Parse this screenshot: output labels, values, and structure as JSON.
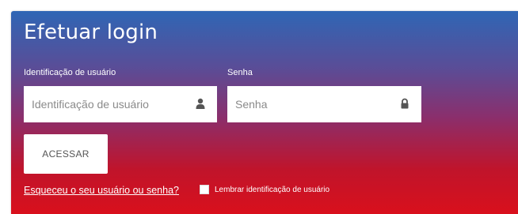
{
  "login": {
    "title": "Efetuar login",
    "username": {
      "label": "Identificação de usuário",
      "placeholder": "Identificação de usuário",
      "icon": "user-icon"
    },
    "password": {
      "label": "Senha",
      "placeholder": "Senha",
      "icon": "lock-icon"
    },
    "submit_label": "ACESSAR",
    "forgot_link": "Esqueceu o seu usuário ou senha?",
    "remember_label": "Lembrar identificação de usuário",
    "remember_checked": false
  },
  "colors": {
    "gradient_top": "#2f66b5",
    "gradient_bottom": "#d9101c",
    "field_bg": "#ffffff",
    "text": "#ffffff"
  }
}
